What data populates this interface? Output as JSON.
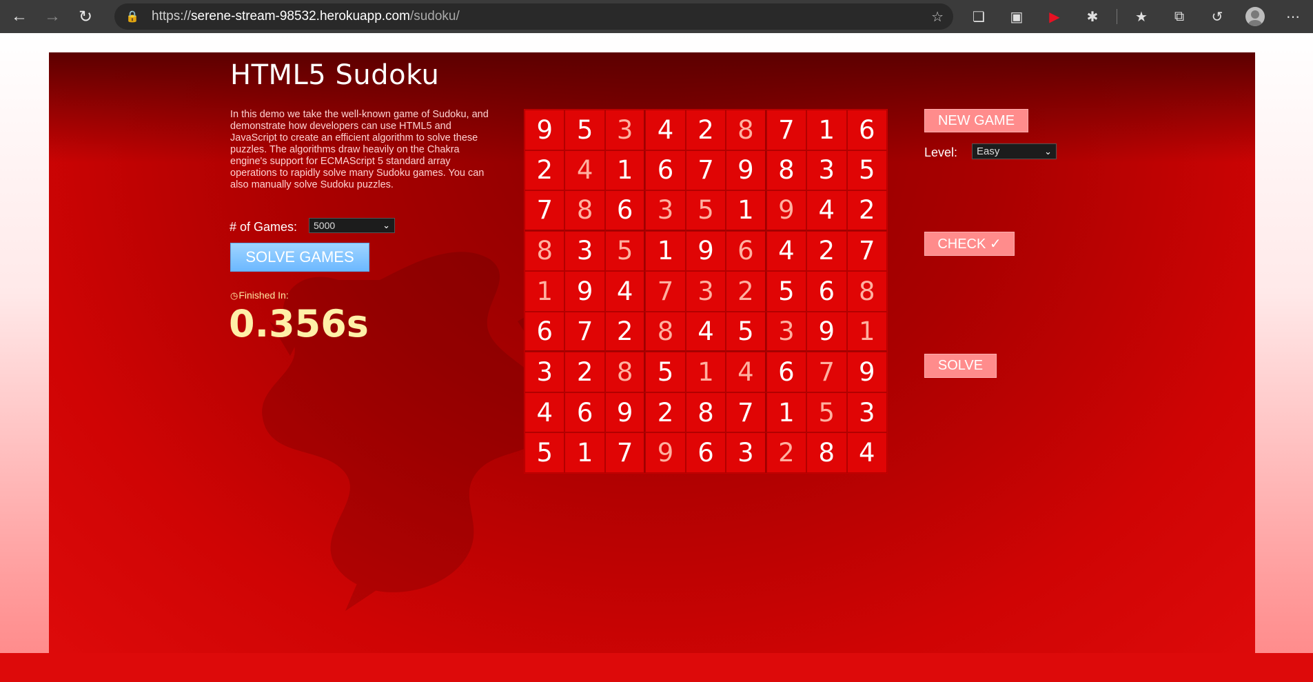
{
  "browser": {
    "url_scheme": "https://",
    "url_host": "serene-stream-98532.herokuapp.com",
    "url_path": "/sudoku/"
  },
  "page": {
    "title": "HTML5 Sudoku",
    "description": "In this demo we take the well-known game of Sudoku, and demonstrate how developers can use HTML5 and JavaScript to create an efficient algorithm to solve these puzzles. The algorithms draw heavily on the Chakra engine's support for ECMAScript 5 standard array operations to rapidly solve many Sudoku games. You can also manually solve Sudoku puzzles.",
    "games_label": "# of Games:",
    "games_value": "5000",
    "solve_games_label": "SOLVE GAMES",
    "finished_label": "Finished In:",
    "finished_time": "0.356s",
    "new_game_label": "NEW GAME",
    "level_label": "Level:",
    "level_value": "Easy",
    "check_label": "CHECK ✓",
    "solve_label": "SOLVE"
  },
  "sudoku": {
    "rows": [
      [
        9,
        5,
        3,
        4,
        2,
        8,
        7,
        1,
        6
      ],
      [
        2,
        4,
        1,
        6,
        7,
        9,
        8,
        3,
        5
      ],
      [
        7,
        8,
        6,
        3,
        5,
        1,
        9,
        4,
        2
      ],
      [
        8,
        3,
        5,
        1,
        9,
        6,
        4,
        2,
        7
      ],
      [
        1,
        9,
        4,
        7,
        3,
        2,
        5,
        6,
        8
      ],
      [
        6,
        7,
        2,
        8,
        4,
        5,
        3,
        9,
        1
      ],
      [
        3,
        2,
        8,
        5,
        1,
        4,
        6,
        7,
        9
      ],
      [
        4,
        6,
        9,
        2,
        8,
        7,
        1,
        5,
        3
      ],
      [
        5,
        1,
        7,
        9,
        6,
        3,
        2,
        8,
        4
      ]
    ],
    "solved_cells": [
      [
        0,
        0,
        1,
        0,
        0,
        1,
        0,
        0,
        0
      ],
      [
        0,
        1,
        0,
        0,
        0,
        0,
        0,
        0,
        0
      ],
      [
        0,
        1,
        0,
        1,
        1,
        0,
        1,
        0,
        0
      ],
      [
        1,
        0,
        1,
        0,
        0,
        1,
        0,
        0,
        0
      ],
      [
        1,
        0,
        0,
        1,
        1,
        1,
        0,
        0,
        1
      ],
      [
        0,
        0,
        0,
        1,
        0,
        0,
        1,
        0,
        1
      ],
      [
        0,
        0,
        1,
        0,
        1,
        1,
        0,
        1,
        0
      ],
      [
        0,
        0,
        0,
        0,
        0,
        0,
        0,
        1,
        0
      ],
      [
        0,
        0,
        0,
        1,
        0,
        0,
        1,
        0,
        0
      ]
    ]
  },
  "colors": {
    "accent_pink": "#ff8c8c",
    "solve_games_blue": "#6cb8ff",
    "time_yellow": "#fff0a8"
  }
}
